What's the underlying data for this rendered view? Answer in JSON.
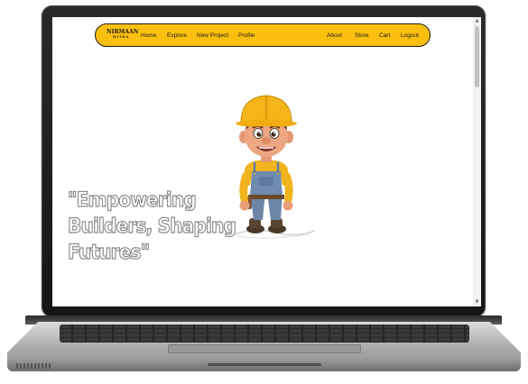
{
  "navbar": {
    "brand_main": "NIRMAAN",
    "brand_sub": "MITRA",
    "links_left": [
      "Home",
      "Explore",
      "New Project",
      "Profile"
    ],
    "links_right": [
      "About",
      "Store",
      "Cart",
      "Logout"
    ],
    "color": "#fbbf10"
  },
  "hero": {
    "tagline_line1": "\"Empowering",
    "tagline_line2": "Builders, Shaping",
    "tagline_line3": "Futures\"",
    "image_icon": "construction-worker-cartoon"
  },
  "scrollbar": {
    "up_icon": "arrow-up-icon",
    "down_icon": "arrow-down-icon"
  }
}
